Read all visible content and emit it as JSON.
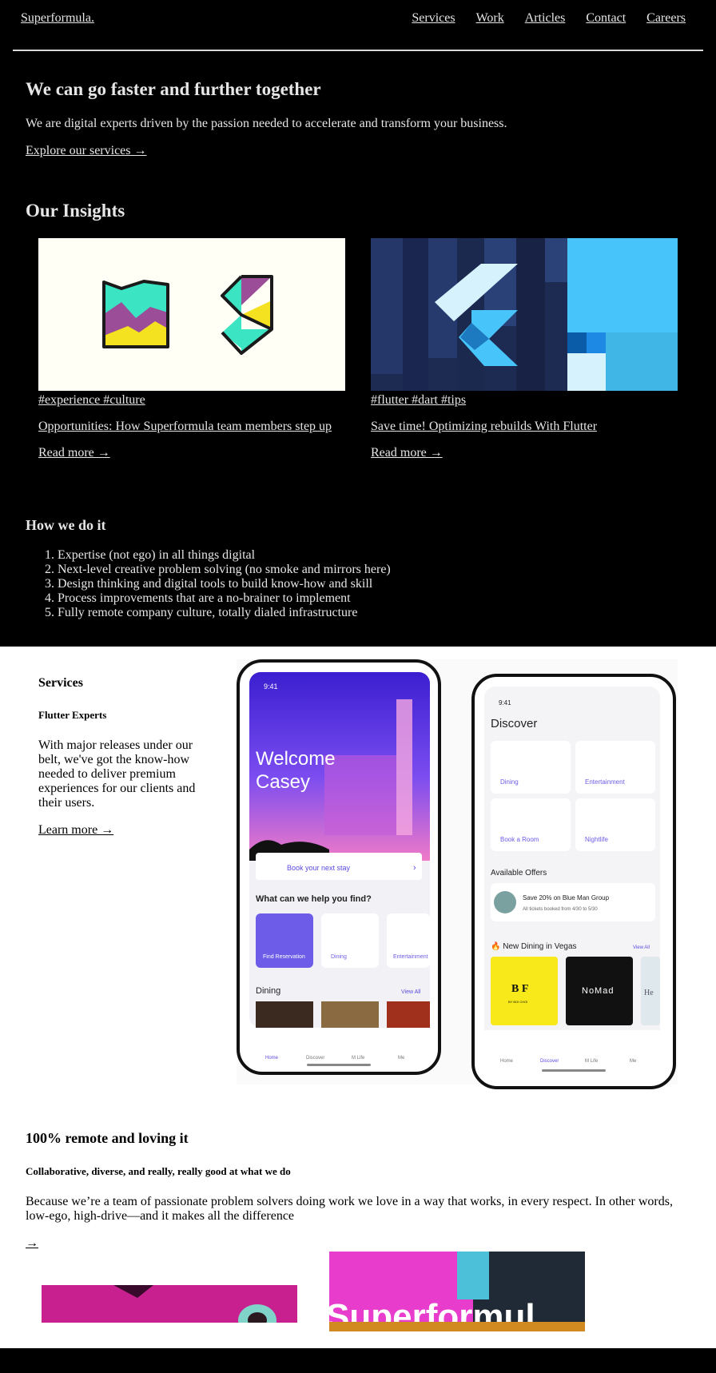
{
  "header": {
    "logo": "Superformula.",
    "nav": [
      "Services",
      "Work",
      "Articles",
      "Contact",
      "Careers"
    ]
  },
  "hero": {
    "title": "We can go faster and further together",
    "text": "We are digital experts driven by the passion needed to accelerate and transform your business.",
    "link": "Explore our services →"
  },
  "insights": {
    "title": "Our Insights",
    "cards": [
      {
        "tags": "#experience #culture",
        "title": "Opportunities: How Superformula team members step up",
        "more": "Read more →"
      },
      {
        "tags": "#flutter #dart #tips",
        "title": "Save time! Optimizing rebuilds With Flutter",
        "more": "Read more →"
      }
    ]
  },
  "how": {
    "title": "How we do it",
    "items": [
      "Expertise (not ego) in all things digital",
      "Next-level creative problem solving (no smoke and mirrors here)",
      "Design thinking and digital tools to build know-how and skill",
      "Process improvements that are a no-brainer to implement",
      "Fully remote company culture, totally dialed infrastructure"
    ]
  },
  "services": {
    "heading": "Services",
    "subheading": "Flutter Experts",
    "text": "With major releases under our belt, we've got the know-how needed to deliver premium experiences for our clients and their users.",
    "link": "Learn more →"
  },
  "phone1": {
    "time": "9:41",
    "welcome": "Welcome",
    "name": "Casey",
    "book": "Book your next stay",
    "help": "What can we help you find?",
    "tiles": [
      "Find Reservation",
      "Dining",
      "Entertainment"
    ],
    "dining": "Dining",
    "view_all": "View All",
    "tabs": [
      "Home",
      "Discover",
      "M Life",
      "Me"
    ]
  },
  "phone2": {
    "time": "9:41",
    "title": "Discover",
    "tiles": [
      "Dining",
      "Entertainment",
      "Book a Room",
      "Nightlife"
    ],
    "offers_title": "Available Offers",
    "offer_title": "Save 20% on Blue Man Group",
    "offer_sub": "All tickets booked from 4/30 to 5/30",
    "new_dining": "🔥 New Dining in Vegas",
    "view_all": "View All",
    "rest1_name": "B F",
    "rest1_sub": "BY BOI CHOI",
    "rest2_name": "NoMad",
    "rest3_name": "He",
    "tabs": [
      "Home",
      "Discover",
      "M Life",
      "Me"
    ]
  },
  "remote": {
    "heading": "100% remote and loving it",
    "subheading": "Collaborative, diverse, and really, really good at what we do",
    "text": "Because we’re a team of passionate problem solvers doing work we love in a way that works, in every respect. In other words, low-ego, high-drive—and it makes all the difference",
    "link": "→",
    "photo_text": "Superformul"
  },
  "colors": {
    "background": "#000000",
    "text": "#e6e6e6",
    "accent_purple": "#6c5ce7",
    "flutter_navy": "#1d2b53",
    "flutter_cyan": "#47c5fb"
  }
}
